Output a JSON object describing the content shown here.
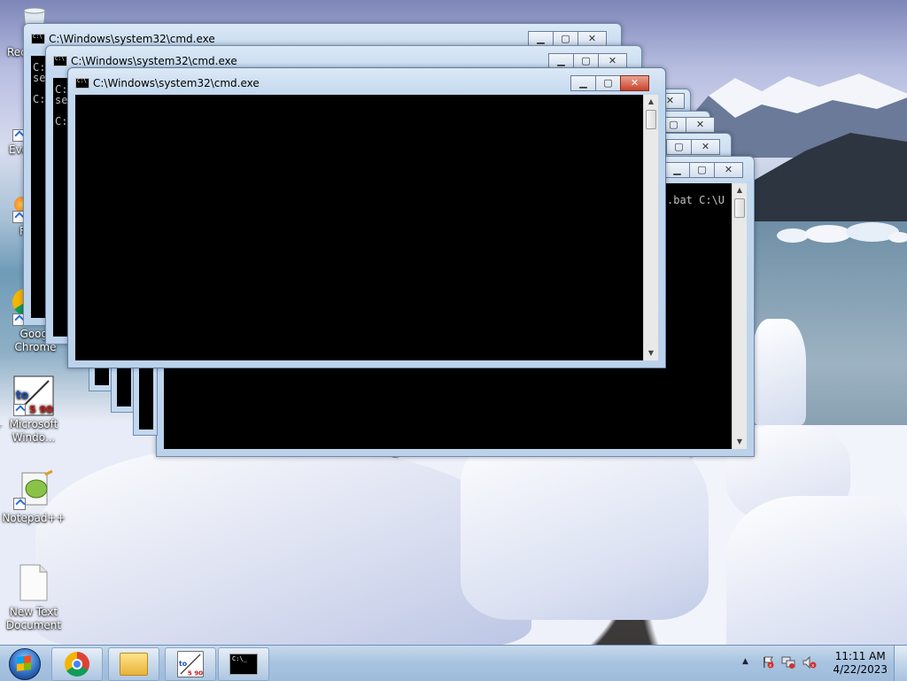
{
  "desktop": {
    "icons": [
      {
        "label": "Rec"
      },
      {
        "label": "Eve"
      },
      {
        "label": "F"
      },
      {
        "label": "Googl Chrome"
      },
      {
        "label": "Microsoft Windo..."
      },
      {
        "label": "Notepad++"
      },
      {
        "label": "New Text Document"
      }
    ]
  },
  "windows": [
    {
      "title": "C:\\Windows\\system32\\cmd.exe",
      "lines": [
        "C:",
        "se",
        "",
        "C:"
      ]
    },
    {
      "title": "C:\\Windows\\system32\\cmd.exe",
      "lines": [
        "C:",
        "se",
        "",
        "C:"
      ]
    },
    {
      "title": "C:\\Windows\\system32\\cmd.exe",
      "lines": [
        ".bat C:\\U"
      ]
    },
    {
      "title": "C:\\Windows\\system32\\cmd.exe",
      "lines": []
    }
  ],
  "window_controls": {
    "minimize": "▁",
    "maximize": "▢",
    "close": "✕"
  },
  "taskbar": {
    "items": [
      {
        "name": "chrome"
      },
      {
        "name": "explorer"
      },
      {
        "name": "microsoft-windows-shortcut"
      },
      {
        "name": "cmd"
      }
    ],
    "tray_arrow": "▲",
    "clock_time": "11:11 AM",
    "clock_date": "4/22/2023"
  }
}
